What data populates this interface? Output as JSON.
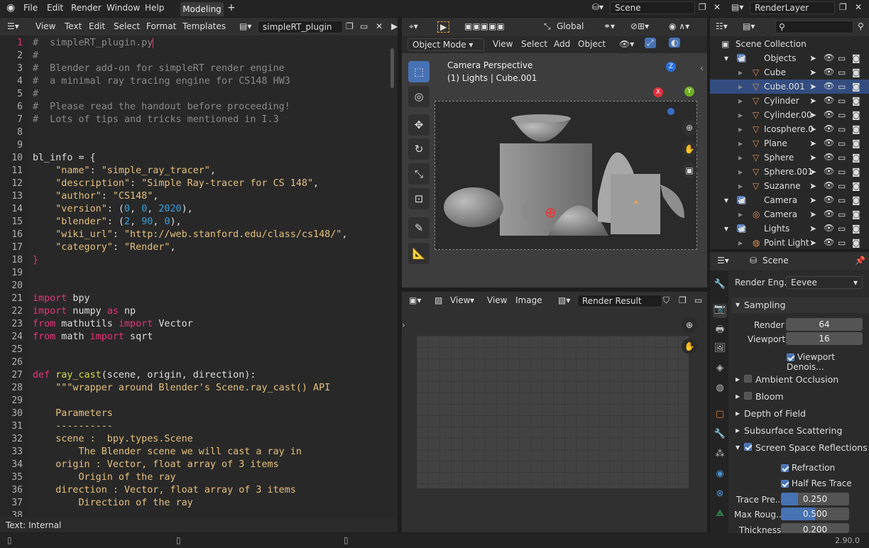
{
  "topbar": {
    "menus": [
      "File",
      "Edit",
      "Render",
      "Window",
      "Help"
    ],
    "workspace_tab": "Modeling",
    "add_tab": "+",
    "scene_label": "Scene",
    "render_layer": "RenderLayer"
  },
  "text_editor": {
    "menus": [
      "View",
      "Text",
      "Edit",
      "Select",
      "Format",
      "Templates"
    ],
    "file_name": "simpleRT_plugin",
    "status": "Text: Internal",
    "lines": [
      {
        "n": "1",
        "t": [
          [
            "com",
            "#  simpleRT_plugin.py"
          ]
        ]
      },
      {
        "n": "2",
        "t": [
          [
            "com",
            "#"
          ]
        ]
      },
      {
        "n": "3",
        "t": [
          [
            "com",
            "#  Blender add-on for simpleRT render engine"
          ]
        ]
      },
      {
        "n": "4",
        "t": [
          [
            "com",
            "#  a minimal ray tracing engine for CS148 HW3"
          ]
        ]
      },
      {
        "n": "5",
        "t": [
          [
            "com",
            "#"
          ]
        ]
      },
      {
        "n": "6",
        "t": [
          [
            "com",
            "#  Please read the handout before proceeding!"
          ]
        ]
      },
      {
        "n": "7",
        "t": [
          [
            "com",
            "#  Lots of tips and tricks mentioned in I.3"
          ]
        ]
      },
      {
        "n": "8",
        "t": []
      },
      {
        "n": "9",
        "t": []
      },
      {
        "n": "10",
        "t": [
          [
            "",
            "bl_info = {"
          ]
        ]
      },
      {
        "n": "11",
        "t": [
          [
            "str",
            "    \"name\""
          ],
          [
            "",
            ": "
          ],
          [
            "str",
            "\"simple_ray_tracer\""
          ],
          [
            "",
            ","
          ]
        ]
      },
      {
        "n": "12",
        "t": [
          [
            "str",
            "    \"description\""
          ],
          [
            "",
            ": "
          ],
          [
            "str",
            "\"Simple Ray-tracer for CS 148\""
          ],
          [
            "",
            ","
          ]
        ]
      },
      {
        "n": "13",
        "t": [
          [
            "str",
            "    \"author\""
          ],
          [
            "",
            ": "
          ],
          [
            "str",
            "\"CS148\""
          ],
          [
            "",
            ","
          ]
        ]
      },
      {
        "n": "14",
        "t": [
          [
            "str",
            "    \"version\""
          ],
          [
            "",
            ": ("
          ],
          [
            "num",
            "0"
          ],
          [
            "",
            ", "
          ],
          [
            "num",
            "0"
          ],
          [
            "",
            ", "
          ],
          [
            "num",
            "2020"
          ],
          [
            "",
            "),"
          ]
        ]
      },
      {
        "n": "15",
        "t": [
          [
            "str",
            "    \"blender\""
          ],
          [
            "",
            ": ("
          ],
          [
            "num",
            "2"
          ],
          [
            "",
            ", "
          ],
          [
            "num",
            "90"
          ],
          [
            "",
            ", "
          ],
          [
            "num",
            "0"
          ],
          [
            "",
            "),"
          ]
        ]
      },
      {
        "n": "16",
        "t": [
          [
            "str",
            "    \"wiki_url\""
          ],
          [
            "",
            ": "
          ],
          [
            "str",
            "\"http://web.stanford.edu/class/cs148/\""
          ],
          [
            "",
            ","
          ]
        ]
      },
      {
        "n": "17",
        "t": [
          [
            "str",
            "    \"category\""
          ],
          [
            "",
            ": "
          ],
          [
            "str",
            "\"Render\""
          ],
          [
            "",
            ","
          ]
        ]
      },
      {
        "n": "18",
        "t": [
          [
            "kw",
            "}"
          ]
        ]
      },
      {
        "n": "19",
        "t": []
      },
      {
        "n": "20",
        "t": []
      },
      {
        "n": "21",
        "t": [
          [
            "kw",
            "import"
          ],
          [
            "",
            " bpy"
          ]
        ]
      },
      {
        "n": "22",
        "t": [
          [
            "kw",
            "import"
          ],
          [
            "",
            " numpy "
          ],
          [
            "kw",
            "as"
          ],
          [
            "",
            " np"
          ]
        ]
      },
      {
        "n": "23",
        "t": [
          [
            "kw",
            "from"
          ],
          [
            "",
            " mathutils "
          ],
          [
            "kw",
            "import"
          ],
          [
            "",
            " Vector"
          ]
        ]
      },
      {
        "n": "24",
        "t": [
          [
            "kw",
            "from"
          ],
          [
            "",
            " math "
          ],
          [
            "kw",
            "import"
          ],
          [
            "",
            " sqrt"
          ]
        ]
      },
      {
        "n": "25",
        "t": []
      },
      {
        "n": "26",
        "t": []
      },
      {
        "n": "27",
        "t": [
          [
            "kw",
            "def"
          ],
          [
            "fn",
            " ray_cast"
          ],
          [
            "",
            "(scene, origin, direction):"
          ]
        ]
      },
      {
        "n": "28",
        "t": [
          [
            "doc",
            "    \"\"\"wrapper around Blender's Scene.ray_cast() API"
          ]
        ]
      },
      {
        "n": "29",
        "t": []
      },
      {
        "n": "30",
        "t": [
          [
            "doc",
            "    Parameters"
          ]
        ]
      },
      {
        "n": "31",
        "t": [
          [
            "doc",
            "    ----------"
          ]
        ]
      },
      {
        "n": "32",
        "t": [
          [
            "doc",
            "    scene :  bpy.types.Scene"
          ]
        ]
      },
      {
        "n": "33",
        "t": [
          [
            "doc",
            "        The Blender scene we will cast a ray in"
          ]
        ]
      },
      {
        "n": "34",
        "t": [
          [
            "doc",
            "    origin : Vector, float array of 3 items"
          ]
        ]
      },
      {
        "n": "35",
        "t": [
          [
            "doc",
            "        Origin of the ray"
          ]
        ]
      },
      {
        "n": "36",
        "t": [
          [
            "doc",
            "    direction : Vector, float array of 3 items"
          ]
        ]
      },
      {
        "n": "37",
        "t": [
          [
            "doc",
            "        Direction of the ray"
          ]
        ]
      },
      {
        "n": "38",
        "t": []
      }
    ]
  },
  "viewport": {
    "global_label": "Global",
    "mode": "Object Mode",
    "menus": [
      "View",
      "Select",
      "Add",
      "Object"
    ],
    "camera_title": "Camera Perspective",
    "camera_sub": "(1) Lights | Cube.001",
    "axes": {
      "x": "X",
      "y": "Y",
      "z": "Z"
    }
  },
  "image_editor": {
    "menus": [
      "View",
      "View",
      "Image"
    ],
    "image_name": "Render Result"
  },
  "outliner": {
    "root": "Scene Collection",
    "rows": [
      {
        "label": "Objects",
        "indent": 0
      },
      {
        "label": "Cube",
        "indent": 1
      },
      {
        "label": "Cube.001",
        "indent": 1
      },
      {
        "label": "Cylinder",
        "indent": 1
      },
      {
        "label": "Cylinder.00",
        "indent": 1
      },
      {
        "label": "Icosphere.0",
        "indent": 1
      },
      {
        "label": "Plane",
        "indent": 1
      },
      {
        "label": "Sphere",
        "indent": 1
      },
      {
        "label": "Sphere.001",
        "indent": 1
      },
      {
        "label": "Suzanne",
        "indent": 1
      },
      {
        "label": "Camera",
        "indent": 0
      },
      {
        "label": "Camera",
        "indent": 1
      },
      {
        "label": "Lights",
        "indent": 0
      },
      {
        "label": "Point Light",
        "indent": 1
      }
    ]
  },
  "properties": {
    "scene_name": "Scene",
    "render_engine_label": "Render Eng...",
    "render_engine": "Eevee",
    "sampling": "Sampling",
    "render_label": "Render",
    "render_value": "64",
    "viewport_label": "Viewport",
    "viewport_value": "16",
    "viewport_denoise": "Viewport Denois...",
    "panels": [
      "Ambient Occlusion",
      "Bloom",
      "Depth of Field",
      "Subsurface Scattering",
      "Screen Space Reflections"
    ],
    "refraction": "Refraction",
    "half_res": "Half Res Trace",
    "trace_label": "Trace Pre...",
    "trace_value": "0.250",
    "trace_fraction": 0.25,
    "maxr_label": "Max Roug...",
    "maxr_value": "0.500",
    "maxr_fraction": 0.5,
    "thick_label": "Thickness",
    "thick_value": "0.200",
    "thick_fraction": 0.0
  },
  "version": "2.90.0",
  "colors": {
    "accent": "#4772b3",
    "keyword": "#e8327c",
    "string": "#e5c07b",
    "number": "#3aa0e0"
  }
}
